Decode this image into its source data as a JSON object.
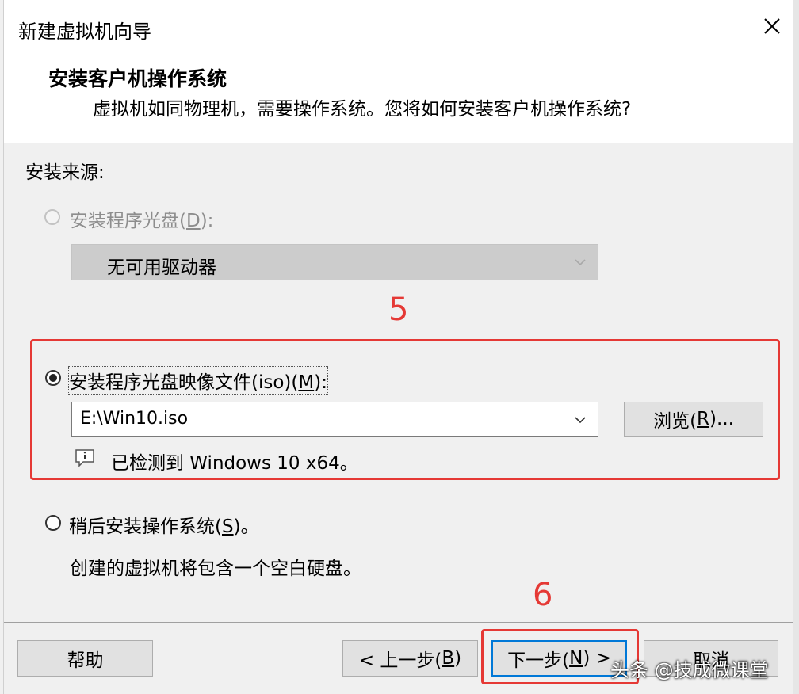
{
  "window": {
    "title": "新建虚拟机向导"
  },
  "header": {
    "heading": "安装客户机操作系统",
    "subheading": "虚拟机如同物理机，需要操作系统。您将如何安装客户机操作系统?"
  },
  "source_label": "安装来源:",
  "options": {
    "disc": {
      "label_pre": "安装程序光盘(",
      "mnemonic": "D",
      "label_post": "):",
      "enabled": false,
      "selected": false
    },
    "disc_drive": {
      "value": "无可用驱动器"
    },
    "iso": {
      "label_pre": "安装程序光盘映像文件(iso)(",
      "mnemonic": "M",
      "label_post": "):",
      "enabled": true,
      "selected": true
    },
    "iso_path": {
      "value": "E:\\Win10.iso"
    },
    "browse": {
      "label_pre": "浏览(",
      "mnemonic": "R",
      "label_post": ")..."
    },
    "detected": "已检测到 Windows 10 x64。",
    "later": {
      "label_pre": "稍后安装操作系统(",
      "mnemonic": "S",
      "label_post": ")。",
      "selected": false
    },
    "later_desc": "创建的虚拟机将包含一个空白硬盘。"
  },
  "footer": {
    "help": "帮助",
    "back": {
      "label_pre": "< 上一步(",
      "mnemonic": "B",
      "label_post": ")"
    },
    "next": {
      "label_pre": "下一步(",
      "mnemonic": "N",
      "label_post": ") >"
    },
    "cancel": "取消"
  },
  "annotations": {
    "step5": "5",
    "step6": "6"
  },
  "watermark": "头条 @技成微课堂",
  "colors": {
    "annotation": "#e53935",
    "default_button_border": "#0078d7"
  },
  "icons": {
    "close": "close-icon",
    "dropdown": "chevron-down-icon",
    "info": "info-icon"
  }
}
